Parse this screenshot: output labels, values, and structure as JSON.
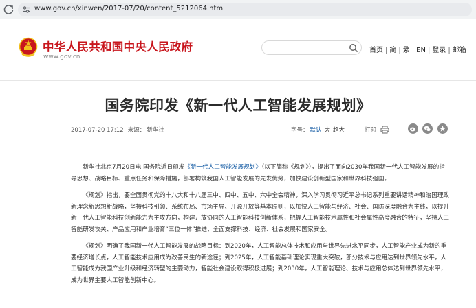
{
  "browser": {
    "url": "www.gov.cn/xinwen/2017-07/20/content_5212064.htm"
  },
  "header": {
    "site_name": "中华人民共和国中央人民政府",
    "domain": "www.gov.cn",
    "search_placeholder": "",
    "nav": [
      "首页",
      "简",
      "繁",
      "EN",
      "登录",
      "邮箱"
    ]
  },
  "article": {
    "title": "国务院印发《新一代人工智能发展规划》",
    "date": "2017-07-20 17:12",
    "source_label": "来源：",
    "source": "新华社",
    "font_label": "字号：",
    "font_sizes": [
      "默认",
      "大",
      "超大"
    ],
    "print_label": "打印",
    "paragraphs": [
      {
        "before": "新华社北京7月20日电  国务院近日印发",
        "link": "《新一代人工智能发展规划》",
        "after": "（以下简称《规划》），提出了面向2030年我国新一代人工智能发展的指导思想、战略目标、重点任务和保障措施，部署构筑我国人工智能发展的先发优势，加快建设创新型国家和世界科技强国。"
      },
      {
        "text": "《规划》指出，要全面贯彻党的十八大和十八届三中、四中、五中、六中全会精神，深入学习贯彻习近平总书记系列重要讲话精神和治国理政新理念新思想新战略，坚持科技引领、系统布局、市场主导、开源开放等基本原则，以加快人工智能与经济、社会、国防深度融合为主线，以提升新一代人工智能科技创新能力为主攻方向，构建开放协同的人工智能科技创新体系，把握人工智能技术属性和社会属性高度融合的特征，坚持人工智能研发攻关、产品应用和产业培育“三位一体”推进，全面支撑科技、经济、社会发展和国家安全。"
      },
      {
        "text": "《规划》明确了我国新一代人工智能发展的战略目标：到2020年，人工智能总体技术和应用与世界先进水平同步，人工智能产业成为新的重要经济增长点，人工智能技术应用成为改善民生的新途径；到2025年，人工智能基础理论实现重大突破，部分技术与应用达到世界领先水平，人工智能成为我国产业升级和经济转型的主要动力，智能社会建设取得积极进展；到2030年，人工智能理论、技术与应用总体达到世界领先水平，成为世界主要人工智能创新中心。"
      }
    ]
  },
  "colors": {
    "brand_red": "#c8161d",
    "link_blue": "#1a5fa6",
    "emblem_gold": "#f2c01c"
  }
}
